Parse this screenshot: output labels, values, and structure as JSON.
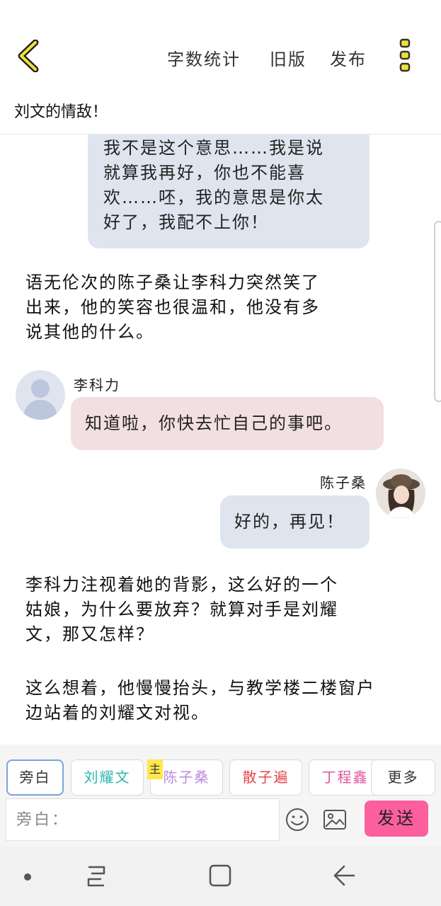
{
  "header": {
    "actions": [
      "字数统计",
      "旧版",
      "发布"
    ]
  },
  "document": {
    "title": "刘文的情敌！"
  },
  "messages": {
    "top_bubble_lines": [
      "我不是这个意思……我是说",
      "就算我再好，你也不能喜",
      "欢……呸，我的意思是你太",
      "好了，我配不上你！"
    ],
    "narration_1": [
      "语无伦次的陈子桑让李科力突然笑了",
      "出来，他的笑容也很温和，他没有多",
      "说其他的什么。"
    ],
    "left_speaker": "李科力",
    "left_message": "知道啦，你快去忙自己的事吧。",
    "right_speaker": "陈子桑",
    "right_message": "好的，再见！",
    "narration_2": [
      "李科力注视着她的背影，这么好的一个",
      "姑娘，为什么要放弃？就算对手是刘耀",
      "文，那又怎样？"
    ],
    "narration_3": [
      "这么想着，他慢慢抬头，与教学楼二楼窗户",
      "边站着的刘耀文对视。"
    ]
  },
  "characters": {
    "chips": [
      "旁白",
      "刘耀文",
      "陈子桑",
      "散子遍",
      "丁程鑫"
    ],
    "main_badge": "主",
    "more_label": "更多",
    "colors": [
      "#333333",
      "#2bb8b0",
      "#b98be0",
      "#e04848",
      "#e0569a"
    ]
  },
  "composer": {
    "placeholder": "旁白：",
    "send_label": "发送"
  },
  "icons": {
    "back": "back-chevron-icon",
    "more": "more-vertical-icon",
    "emoji": "emoji-icon",
    "image": "image-icon",
    "nav_dot": "nav-dot-icon",
    "nav_recents": "recents-icon",
    "nav_home": "home-square-icon",
    "nav_back": "back-arrow-icon"
  }
}
